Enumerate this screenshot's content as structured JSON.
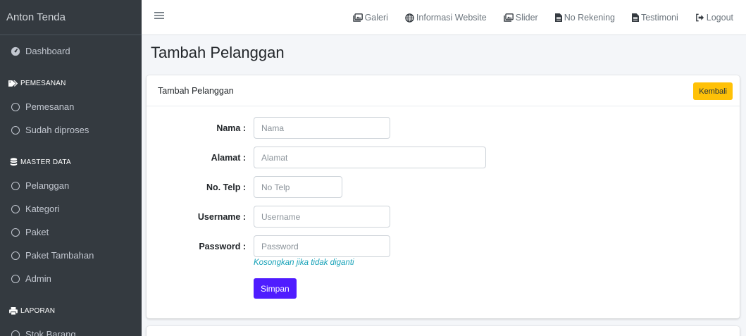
{
  "brand": "Anton Tenda",
  "sidebar": {
    "dashboard": "Dashboard",
    "pemesanan_header": "PEMESANAN",
    "pemesanan": "Pemesanan",
    "sudah_diproses": "Sudah diproses",
    "master_header": "MASTER DATA",
    "pelanggan": "Pelanggan",
    "kategori": "Kategori",
    "paket": "Paket",
    "paket_tambahan": "Paket Tambahan",
    "admin": "Admin",
    "laporan_header": "LAPORAN",
    "stok_barang": "Stok Barang"
  },
  "topnav": {
    "galeri": "Galeri",
    "informasi_website": "Informasi Website",
    "slider": "Slider",
    "no_rekening": "No Rekening",
    "testimoni": "Testimoni",
    "logout": "Logout"
  },
  "page": {
    "title": "Tambah Pelanggan"
  },
  "card": {
    "header": "Tambah Pelanggan",
    "back_label": "Kembali"
  },
  "form": {
    "nama_label": "Nama :",
    "nama_placeholder": "Nama",
    "alamat_label": "Alamat :",
    "alamat_placeholder": "Alamat",
    "telp_label": "No. Telp :",
    "telp_placeholder": "No Telp",
    "username_label": "Username :",
    "username_placeholder": "Username",
    "password_label": "Password :",
    "password_placeholder": "Password",
    "password_hint": "Kosongkan jika tidak diganti",
    "submit_label": "Simpan"
  },
  "colors": {
    "sidebar_bg": "#343a40",
    "warning": "#ffc107",
    "primary": "#4f1cff",
    "hint": "#17a2b8"
  }
}
